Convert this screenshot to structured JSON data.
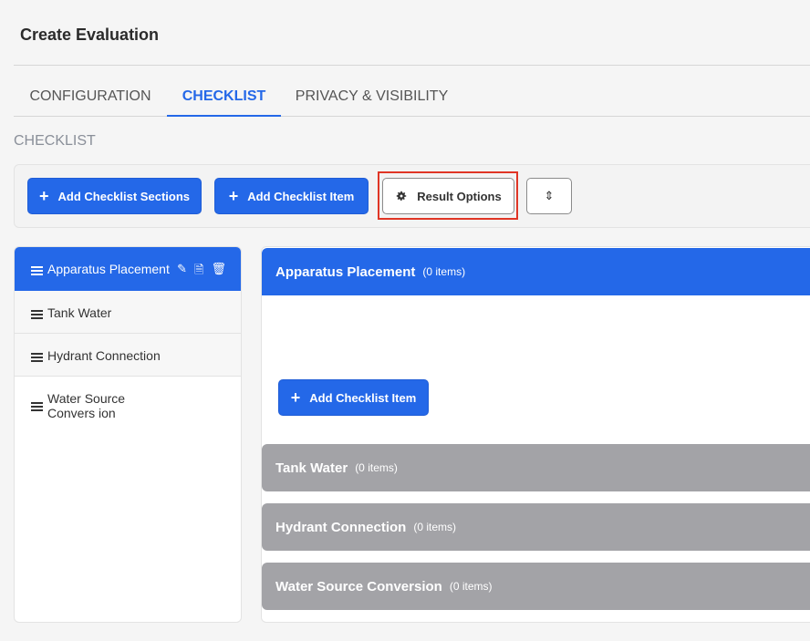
{
  "page": {
    "title": "Create Evaluation"
  },
  "tabs": [
    {
      "label": "CONFIGURATION",
      "active": false
    },
    {
      "label": "CHECKLIST",
      "active": true
    },
    {
      "label": "PRIVACY & VISIBILITY",
      "active": false
    }
  ],
  "section_label": "CHECKLIST",
  "toolbar": {
    "add_sections_label": "Add Checklist Sections",
    "add_item_label": "Add Checklist Item",
    "result_options_label": "Result Options",
    "sort_icon": "⇕"
  },
  "sidebar": {
    "items": [
      {
        "label": "Apparatus Placement",
        "active": true
      },
      {
        "label": "Tank Water",
        "active": false
      },
      {
        "label": "Hydrant Connection",
        "active": false
      },
      {
        "label": "Water Source Convers ion",
        "active": false
      }
    ]
  },
  "panels": [
    {
      "title": "Apparatus Placement",
      "count": "(0 items)",
      "color": "#2468e8"
    },
    {
      "title": "Tank Water",
      "count": "(0 items)",
      "color": "#a3a3a7"
    },
    {
      "title": "Hydrant Connection",
      "count": "(0 items)",
      "color": "#a3a3a7"
    },
    {
      "title": "Water Source Conversion",
      "count": "(0 items)",
      "color": "#a3a3a7"
    }
  ],
  "panel_add_item_label": "Add Checklist Item",
  "colors": {
    "accent": "#2468e8",
    "highlight": "#e03525",
    "collapsed": "#a3a3a7"
  }
}
